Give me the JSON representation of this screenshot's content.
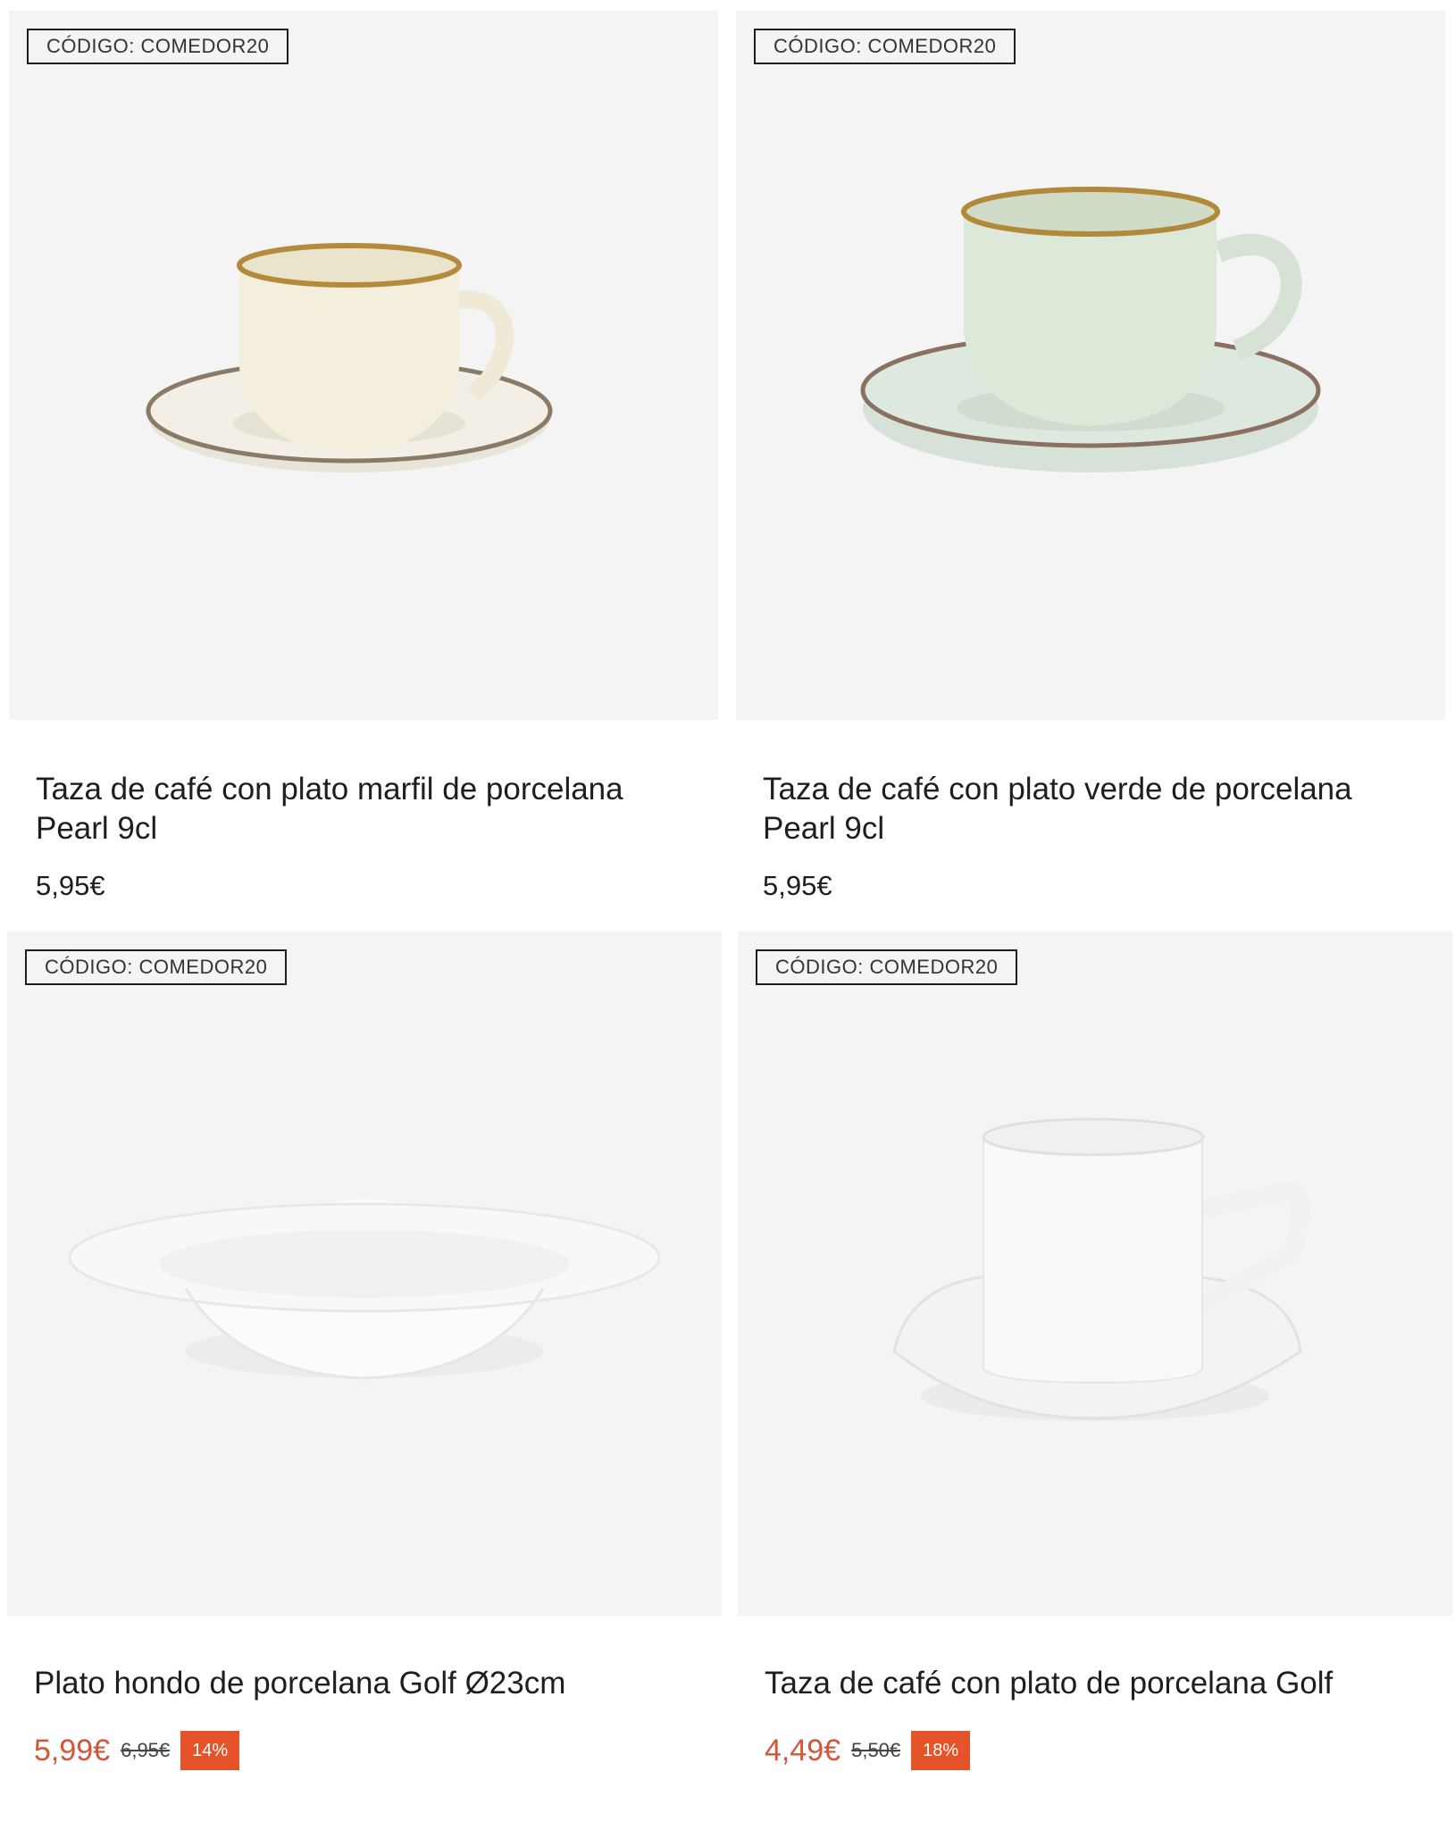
{
  "products": [
    {
      "badge": "CÓDIGO: COMEDOR20",
      "title": "Taza de café con plato marfil de porcelana Pearl 9cl",
      "price": "5,95€",
      "image_icon": "coffee-cup-ivory-icon"
    },
    {
      "badge": "CÓDIGO: COMEDOR20",
      "title": "Taza de café con plato verde de porcelana Pearl 9cl",
      "price": "5,95€",
      "image_icon": "coffee-cup-green-icon"
    },
    {
      "badge": "CÓDIGO: COMEDOR20",
      "title": "Plato hondo de porcelana Golf Ø23cm",
      "price": "5,99€",
      "old_price": "6,95€",
      "discount": "14%",
      "image_icon": "deep-plate-icon"
    },
    {
      "badge": "CÓDIGO: COMEDOR20",
      "title": "Taza de café con plato de porcelana Golf",
      "price": "4,49€",
      "old_price": "5,50€",
      "discount": "18%",
      "image_icon": "coffee-cup-white-icon"
    }
  ],
  "colors": {
    "sale_price": "#d2563a",
    "discount_badge": "#e4532a",
    "image_background": "#f4f4f4"
  }
}
